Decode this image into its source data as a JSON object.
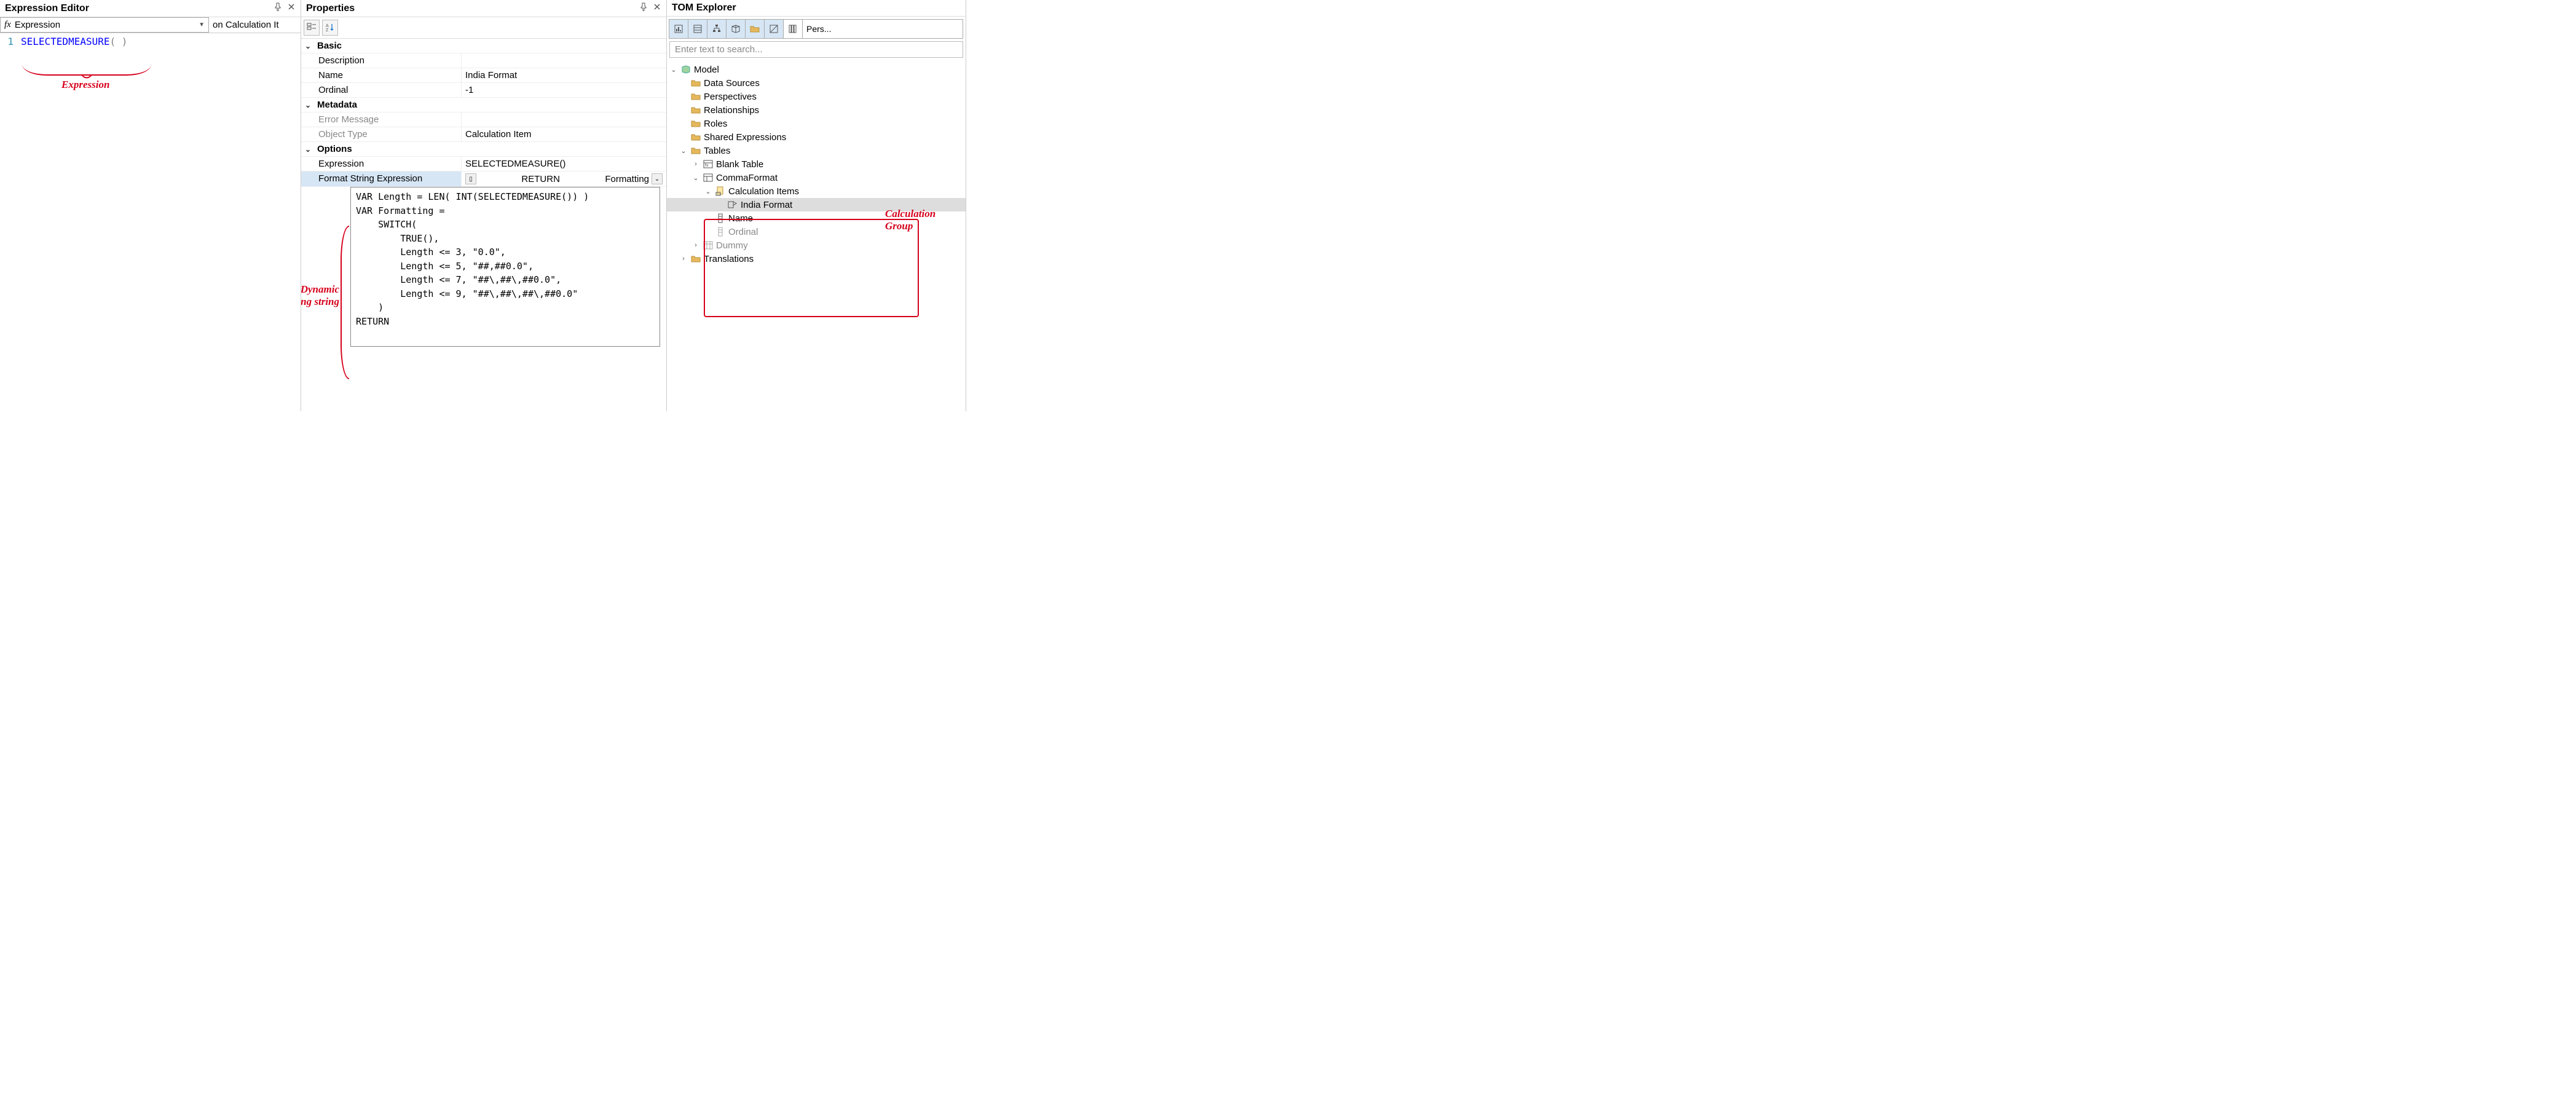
{
  "expressionEditor": {
    "title": "Expression Editor",
    "dropdown_fx": "fx",
    "dropdown_label": "Expression",
    "context": "on Calculation It",
    "line_no": "1",
    "code_func": "SELECTEDMEASURE",
    "code_parens": "( )",
    "annot": "Expression"
  },
  "properties": {
    "title": "Properties",
    "groups": {
      "basic": "Basic",
      "metadata": "Metadata",
      "options": "Options"
    },
    "rows": {
      "description_label": "Description",
      "description_value": "",
      "name_label": "Name",
      "name_value": "India Format",
      "ordinal_label": "Ordinal",
      "ordinal_value": "-1",
      "error_label": "Error Message",
      "error_value": "",
      "objtype_label": "Object Type",
      "objtype_value": "Calculation Item",
      "expression_label": "Expression",
      "expression_value": "SELECTEDMEASURE()",
      "format_label": "Format String Expression",
      "format_return": "RETURN",
      "format_right": "Formatting"
    },
    "format_code": "VAR Length = LEN( INT(SELECTEDMEASURE()) )\nVAR Formatting =\n    SWITCH(\n        TRUE(),\n        Length <= 3, \"0.0\",\n        Length <= 5, \"##,##0.0\",\n        Length <= 7, \"##\\,##\\,##0.0\",\n        Length <= 9, \"##\\,##\\,##\\,##0.0\"\n    )\nRETURN",
    "annot1": "Dynamic",
    "annot2": "formatting string"
  },
  "tom": {
    "title": "TOM Explorer",
    "pers_label": "Pers...",
    "search_placeholder": "Enter text to search...",
    "tree": {
      "model": "Model",
      "data_sources": "Data Sources",
      "perspectives": "Perspectives",
      "relationships": "Relationships",
      "roles": "Roles",
      "shared_expr": "Shared Expressions",
      "tables": "Tables",
      "blank_table": "Blank Table",
      "comma_format": "CommaFormat",
      "calc_items": "Calculation Items",
      "india_format": "India Format",
      "name_col": "Name",
      "ordinal_col": "Ordinal",
      "dummy": "Dummy",
      "translations": "Translations"
    },
    "annot1": "Calculation",
    "annot2": "Group"
  }
}
